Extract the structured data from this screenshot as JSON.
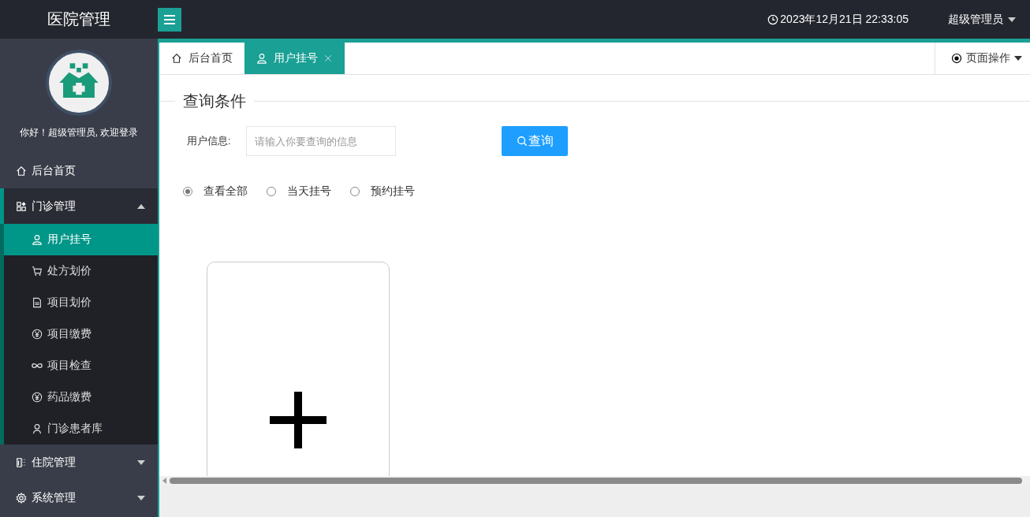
{
  "header": {
    "title": "医院管理",
    "datetime": "2023年12月21日 22:33:05",
    "user": "超级管理员"
  },
  "sidebar": {
    "greeting": "你好！超级管理员, 欢迎登录",
    "items": [
      {
        "label": "后台首页",
        "kind": "link",
        "selected": false
      },
      {
        "label": "门诊管理",
        "kind": "group",
        "expanded": true,
        "selected": false,
        "children": [
          {
            "label": "用户挂号",
            "selected": true
          },
          {
            "label": "处方划价",
            "selected": false
          },
          {
            "label": "项目划价",
            "selected": false
          },
          {
            "label": "项目缴费",
            "selected": false
          },
          {
            "label": "项目检查",
            "selected": false
          },
          {
            "label": "药品缴费",
            "selected": false
          },
          {
            "label": "门诊患者库",
            "selected": false
          }
        ]
      },
      {
        "label": "住院管理",
        "kind": "group",
        "expanded": false,
        "selected": false
      },
      {
        "label": "系统管理",
        "kind": "group",
        "expanded": false,
        "selected": false
      }
    ]
  },
  "tabs": [
    {
      "label": "后台首页",
      "selected": false
    },
    {
      "label": "用户挂号",
      "selected": true
    }
  ],
  "page_ops": "页面操作",
  "query": {
    "legend": "查询条件",
    "label": "用户信息:",
    "placeholder": "请输入你要查询的信息",
    "button": "查询",
    "options": [
      {
        "label": "查看全部",
        "selected": true
      },
      {
        "label": "当天挂号",
        "selected": false
      },
      {
        "label": "预约挂号",
        "selected": false
      }
    ]
  }
}
